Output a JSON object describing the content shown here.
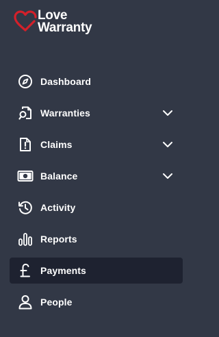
{
  "brand": {
    "line1": "Love",
    "line2": "Warranty",
    "accent_color": "#d4202a",
    "logo_icon": "heart-logo-icon"
  },
  "nav": {
    "items": [
      {
        "label": "Dashboard",
        "icon": "compass-icon",
        "expandable": false,
        "active": false
      },
      {
        "label": "Warranties",
        "icon": "document-search-icon",
        "expandable": true,
        "active": false
      },
      {
        "label": "Claims",
        "icon": "document-alert-icon",
        "expandable": true,
        "active": false
      },
      {
        "label": "Balance",
        "icon": "banknote-icon",
        "expandable": true,
        "active": false
      },
      {
        "label": "Activity",
        "icon": "history-icon",
        "expandable": false,
        "active": false
      },
      {
        "label": "Reports",
        "icon": "bar-chart-icon",
        "expandable": false,
        "active": false
      },
      {
        "label": "Payments",
        "icon": "pound-icon",
        "expandable": false,
        "active": true
      },
      {
        "label": "People",
        "icon": "person-icon",
        "expandable": false,
        "active": false
      }
    ]
  },
  "colors": {
    "sidebar_bg": "#323846",
    "active_bg": "#1e2230",
    "text": "#ffffff"
  }
}
